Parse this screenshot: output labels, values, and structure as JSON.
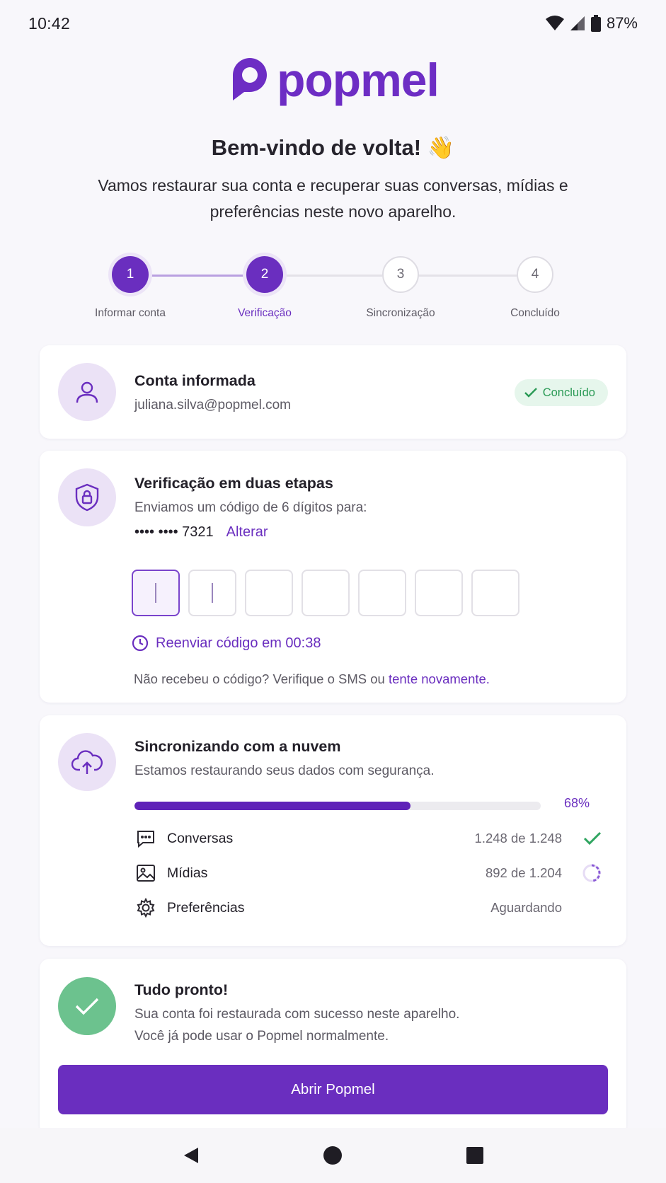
{
  "status_bar": {
    "time": "10:42",
    "battery": "87%"
  },
  "brand": {
    "name": "popmel",
    "accent": "#6a2ebf",
    "success": "#6cc28e"
  },
  "welcome": {
    "title": "Bem-vindo de volta! 👋",
    "subtitle": "Vamos restaurar sua conta e recuperar suas conversas, mídias e preferências neste novo aparelho."
  },
  "stepper": {
    "current_step": 2,
    "steps": [
      {
        "number": "1",
        "label": "Informar conta",
        "state": "done"
      },
      {
        "number": "2",
        "label": "Verificação",
        "state": "current"
      },
      {
        "number": "3",
        "label": "Sincronização",
        "state": "pending"
      },
      {
        "number": "4",
        "label": "Concluído",
        "state": "pending"
      }
    ]
  },
  "account_card": {
    "icon": "user-icon",
    "title": "Conta informada",
    "email": "juliana.silva@popmel.com",
    "badge": "Concluído"
  },
  "verification_card": {
    "icon": "shield-lock-icon",
    "title": "Verificação em duas etapas",
    "description": "Enviamos um código de 6 dígitos para:",
    "masked_phone": "•••• •••• 7321",
    "change_link": "Alterar",
    "code_boxes": [
      "",
      "",
      "",
      "",
      "",
      "",
      ""
    ],
    "resend_label": "Reenviar código em 00:38",
    "help_text": "Não recebeu o código? Verifique o SMS ou",
    "help_link": "tente novamente."
  },
  "sync_card": {
    "icon": "cloud-upload-icon",
    "title": "Sincronizando com a nuvem",
    "description": "Estamos restaurando seus dados com segurança.",
    "progress_percent": 68,
    "progress_label": "68%",
    "items": [
      {
        "icon": "chat-icon",
        "label": "Conversas",
        "count": "1.248 de 1.248",
        "state": "done"
      },
      {
        "icon": "image-icon",
        "label": "Mídias",
        "count": "892 de 1.204",
        "state": "loading"
      },
      {
        "icon": "gear-icon",
        "label": "Preferências",
        "count": "Aguardando",
        "state": "waiting"
      }
    ]
  },
  "done_card": {
    "icon": "check-icon",
    "title": "Tudo pronto!",
    "line1": "Sua conta foi restaurada com sucesso neste aparelho.",
    "line2": "Você já pode usar o Popmel normalmente.",
    "button_label": "Abrir Popmel"
  },
  "nav_bar": {
    "items": [
      "back-icon",
      "home-icon",
      "recents-icon"
    ]
  }
}
